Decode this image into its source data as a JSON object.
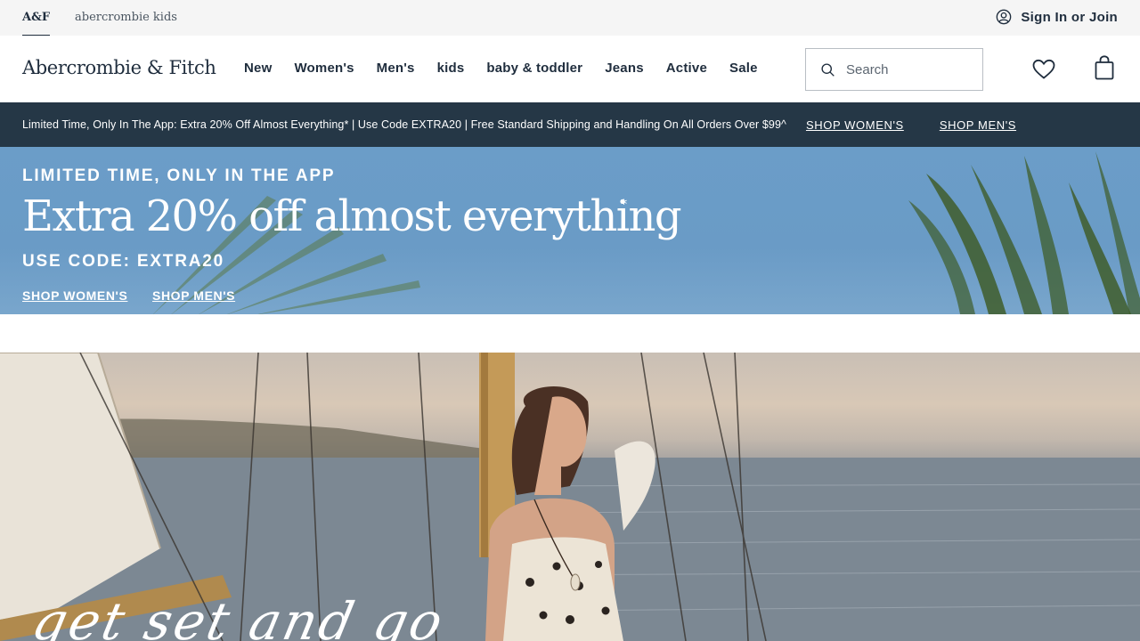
{
  "utility": {
    "brand_af": "A&F",
    "brand_kids": "abercrombie kids",
    "sign_in": "Sign In or Join"
  },
  "header": {
    "logo": "Abercrombie & Fitch",
    "nav": [
      "New",
      "Women's",
      "Men's",
      "kids",
      "baby & toddler",
      "Jeans",
      "Active",
      "Sale"
    ],
    "search_placeholder": "Search"
  },
  "promo": {
    "text": "Limited Time, Only In The App: Extra 20% Off Almost Everything* | Use Code EXTRA20 | Free Standard Shipping and Handling On All Orders Over $99^",
    "link_women": "SHOP WOMEN'S",
    "link_men": "SHOP MEN'S"
  },
  "hero": {
    "eyebrow": "LIMITED TIME, ONLY IN THE APP",
    "headline": "Extra 20% off almost everything",
    "asterisk": "*",
    "code": "USE CODE: EXTRA20",
    "link_women": "SHOP WOMEN'S",
    "link_men": "SHOP MEN'S"
  },
  "lifestyle": {
    "script": "get set and go"
  },
  "colors": {
    "navy": "#253746",
    "text": "#1f2d3d",
    "hero_sky": "#6a9bc6"
  }
}
